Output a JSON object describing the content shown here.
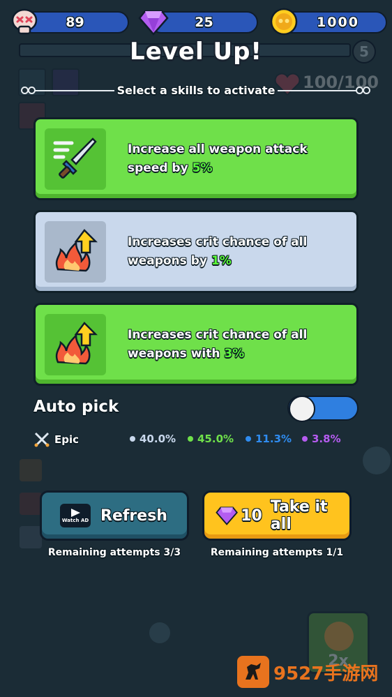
{
  "resources": {
    "skulls": "89",
    "gems": "25",
    "coins": "1000"
  },
  "level": {
    "number": "5",
    "hp_label": "100/100"
  },
  "title": "Level Up!",
  "subtitle": "Select a skills to activate",
  "skills": [
    {
      "text_before": "Increase all weapon attack speed by ",
      "highlight": "5%",
      "text_after": "",
      "style": "green",
      "icon": "sword-speed-icon"
    },
    {
      "text_before": "Increases crit chance of all weapons by ",
      "highlight": "1%",
      "text_after": "",
      "style": "blue",
      "icon": "crit-fire-icon"
    },
    {
      "text_before": "Increases crit chance of all weapons with ",
      "highlight": "3%",
      "text_after": "",
      "style": "green",
      "icon": "crit-fire-icon"
    }
  ],
  "auto_pick": {
    "label": "Auto pick",
    "enabled": false
  },
  "rarity": {
    "label": "Epic",
    "rates": [
      {
        "value": "40.0%",
        "color": "#c9d8ec"
      },
      {
        "value": "45.0%",
        "color": "#6fe04a"
      },
      {
        "value": "11.3%",
        "color": "#2f8cf0"
      },
      {
        "value": "3.8%",
        "color": "#b65cf0"
      }
    ]
  },
  "buttons": {
    "refresh_label": "Refresh",
    "watch_ad_label": "Watch AD",
    "refresh_attempts": "Remaining attempts 3/3",
    "take_all_cost": "10",
    "take_all_label": "Take it all",
    "take_all_attempts": "Remaining attempts 1/1"
  },
  "speed_button_label": "2x",
  "watermark": "9527手游网"
}
